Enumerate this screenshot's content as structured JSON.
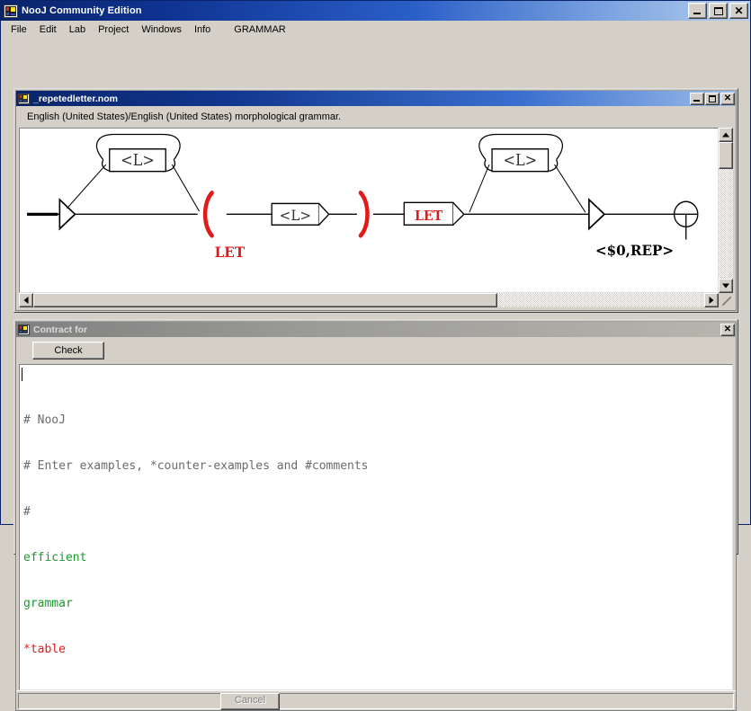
{
  "app": {
    "title": "NooJ Community Edition",
    "icon": "nooj-app-icon",
    "window_buttons": [
      {
        "name": "minimize",
        "glyph": "_"
      },
      {
        "name": "maximize",
        "glyph": "□"
      },
      {
        "name": "close",
        "glyph": "✕"
      }
    ]
  },
  "menubar": {
    "items": [
      {
        "label": "File"
      },
      {
        "label": "Edit"
      },
      {
        "label": "Lab"
      },
      {
        "label": "Project"
      },
      {
        "label": "Windows"
      },
      {
        "label": "Info"
      },
      {
        "label": "GRAMMAR"
      }
    ]
  },
  "grammar_window": {
    "title": "_repetedletter.nom",
    "description": "English (United States)/English (United States) morphological grammar.",
    "buttons": [
      {
        "name": "minimize",
        "glyph": "_"
      },
      {
        "name": "maximize",
        "glyph": "□"
      },
      {
        "name": "close",
        "glyph": "✕"
      }
    ],
    "graph": {
      "nodes": [
        {
          "id": "start",
          "type": "initial-triangle",
          "label": ""
        },
        {
          "id": "loop1",
          "type": "box-loop",
          "label": "<L>"
        },
        {
          "id": "openparen",
          "type": "paren-open",
          "label": "(",
          "sublabel": "LET",
          "color": "#e01b1b"
        },
        {
          "id": "mid",
          "type": "box",
          "label": "<L>"
        },
        {
          "id": "closeparen",
          "type": "paren-close",
          "label": ")",
          "color": "#e01b1b"
        },
        {
          "id": "let",
          "type": "box",
          "label": "LET",
          "color": "#e01b1b"
        },
        {
          "id": "loop2",
          "type": "box-loop",
          "label": "<L>"
        },
        {
          "id": "output",
          "type": "triangle-out",
          "label": "<$0,REP>"
        },
        {
          "id": "final",
          "type": "terminal-circle",
          "label": ""
        }
      ]
    }
  },
  "contract_window": {
    "title": "Contract for",
    "close_button": {
      "name": "close",
      "glyph": "✕"
    },
    "check_button_label": "Check",
    "editor_lines": [
      {
        "text": "# NooJ",
        "style": "comment"
      },
      {
        "text": "# Enter examples, *counter-examples and #comments",
        "style": "comment"
      },
      {
        "text": "#",
        "style": "comment"
      },
      {
        "text": "efficient",
        "style": "ok"
      },
      {
        "text": "grammar",
        "style": "ok"
      },
      {
        "text": "*table",
        "style": "bad"
      }
    ]
  },
  "statusbar": {
    "cancel_label": "Cancel"
  },
  "colors": {
    "title_active": "#0a246a",
    "title_inactive": "#808080",
    "face": "#d4d0c8",
    "accent_red": "#e01b1b",
    "accent_green": "#1a9a2a",
    "comment_gray": "#6b6b6b"
  }
}
